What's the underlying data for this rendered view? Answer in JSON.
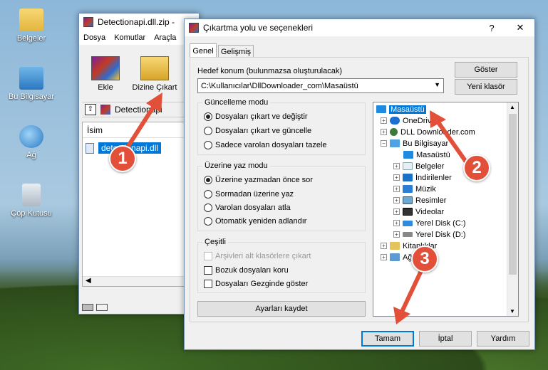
{
  "desktop": {
    "icons": [
      {
        "label": "Belgeler"
      },
      {
        "label": "Bu Bilgisayar"
      },
      {
        "label": "Ağ"
      },
      {
        "label": "Çöp Kutusu"
      }
    ]
  },
  "winrar": {
    "title": "Detectionapi.dll.zip -",
    "menu": [
      "Dosya",
      "Komutlar",
      "Araçla"
    ],
    "toolbar": {
      "add_label": "Ekle",
      "extract_label": "Dizine Çıkart"
    },
    "path_text": "Detectionapi",
    "column_header": "İsim",
    "file_name": "detectionapi.dll"
  },
  "dialog": {
    "title": "Çıkartma yolu ve seçenekleri",
    "help_glyph": "?",
    "close_glyph": "✕",
    "tabs": [
      "Genel",
      "Gelişmiş"
    ],
    "dest_label": "Hedef konum (bulunmazsa oluşturulacak)",
    "dest_value": "C:\\Kullanıcılar\\DllDownloader_com\\Masaüstü",
    "show_btn": "Göster",
    "new_folder_btn": "Yeni klasör",
    "update_mode": {
      "title": "Güncelleme modu",
      "options": [
        "Dosyaları çıkart ve değiştir",
        "Dosyaları çıkart ve güncelle",
        "Sadece varolan dosyaları tazele"
      ],
      "selected": 0
    },
    "overwrite_mode": {
      "title": "Üzerine yaz modu",
      "options": [
        "Üzerine yazmadan önce sor",
        "Sormadan üzerine yaz",
        "Varolan dosyaları atla",
        "Otomatik yeniden adlandır"
      ],
      "selected": 0
    },
    "misc": {
      "title": "Çeşitli",
      "options": [
        "Arşivleri alt klasörlere çıkart",
        "Bozuk dosyaları koru",
        "Dosyaları Gezginde göster"
      ]
    },
    "save_settings_btn": "Ayarları kaydet",
    "tree": [
      {
        "label": "Masaüstü"
      },
      {
        "label": "OneDrive"
      },
      {
        "label": "DLL Downloader.com"
      },
      {
        "label": "Bu Bilgisayar"
      },
      {
        "label": "Masaüstü"
      },
      {
        "label": "Belgeler"
      },
      {
        "label": "İndirilenler"
      },
      {
        "label": "Müzik"
      },
      {
        "label": "Resimler"
      },
      {
        "label": "Videolar"
      },
      {
        "label": "Yerel Disk (C:)"
      },
      {
        "label": "Yerel Disk (D:)"
      },
      {
        "label": "Kitaplıklar"
      },
      {
        "label": "Ağ"
      }
    ],
    "ok_btn": "Tamam",
    "cancel_btn": "İptal",
    "help_btn": "Yardım"
  },
  "annotations": [
    "1",
    "2",
    "3"
  ],
  "colors": {
    "accent": "#0078d7",
    "marker": "#e2503a",
    "selection": "#0078d7"
  }
}
